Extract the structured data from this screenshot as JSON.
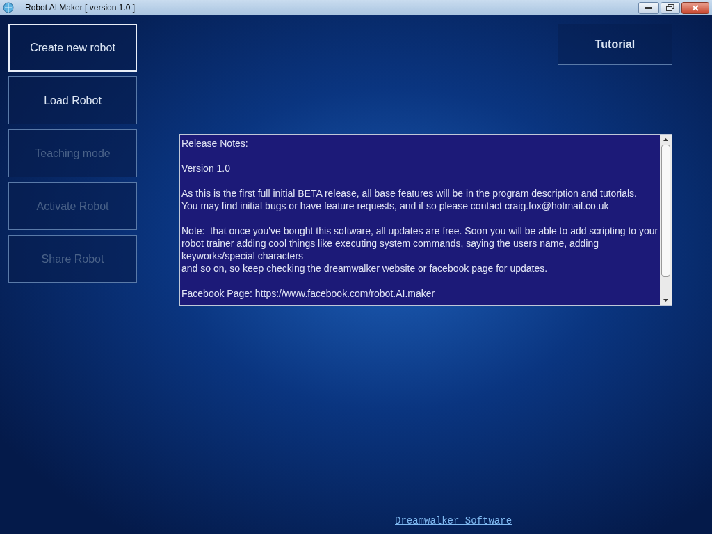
{
  "window": {
    "title": "Robot AI Maker [ version 1.0 ]"
  },
  "menu_buttons": [
    {
      "label": "Create new robot",
      "disabled": false,
      "focused": true
    },
    {
      "label": "Load Robot",
      "disabled": false,
      "focused": false
    },
    {
      "label": "Teaching mode",
      "disabled": true,
      "focused": false
    },
    {
      "label": "Activate Robot",
      "disabled": true,
      "focused": false
    },
    {
      "label": "Share Robot",
      "disabled": true,
      "focused": false
    }
  ],
  "tutorial_button": {
    "label": "Tutorial"
  },
  "release_notes": {
    "paragraphs": [
      [
        "Release Notes:"
      ],
      [
        "Version 1.0"
      ],
      [
        "As this is the first full initial BETA release, all base features will be in the program description and tutorials.",
        "You may find initial bugs or have feature requests, and if so please contact craig.fox@hotmail.co.uk"
      ],
      [
        "Note:  that once you've bought this software, all updates are free. Soon you will be able to add scripting to your robot trainer adding cool things like executing system commands, saying the users name, adding keyworks/special characters",
        "and so on, so keep checking the dreamwalker website or facebook page for updates."
      ],
      [
        "Facebook Page: https://www.facebook.com/robot.AI.maker"
      ]
    ]
  },
  "footer_link": "Dreamwalker Software"
}
